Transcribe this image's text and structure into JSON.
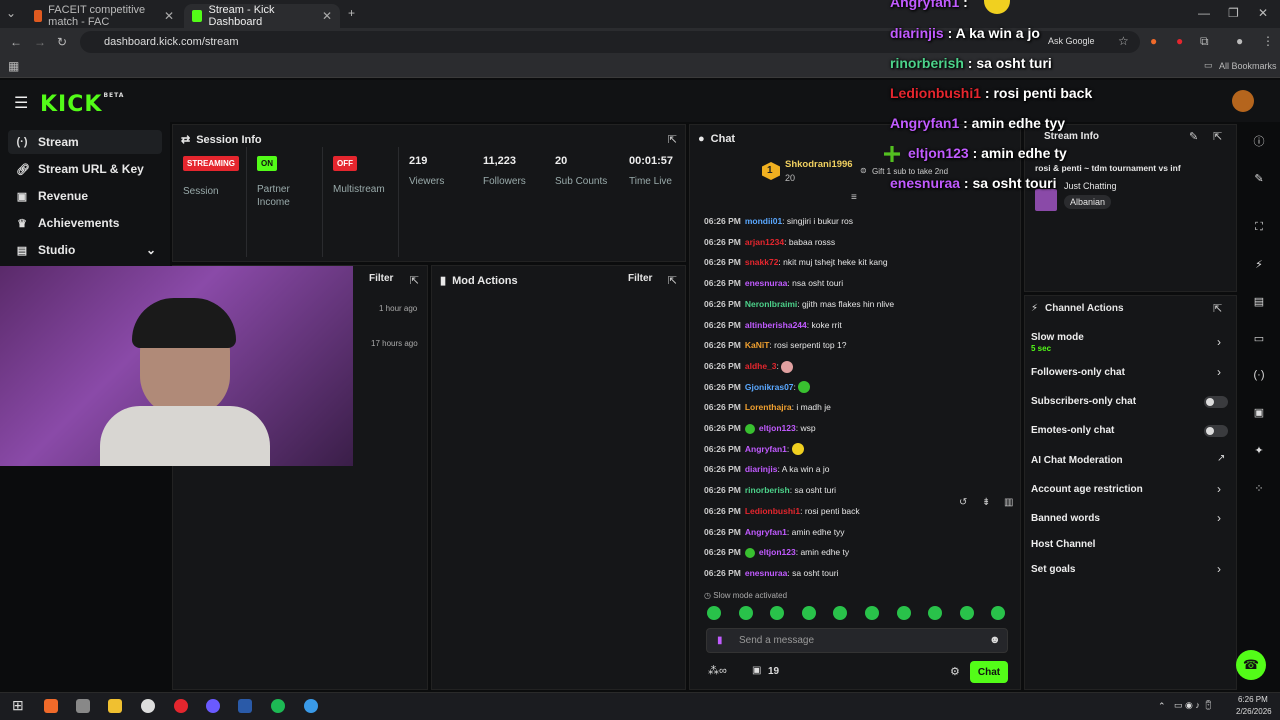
{
  "browser": {
    "tabs": [
      {
        "label": "FACEIT competitive match - FAC"
      },
      {
        "label": "Stream - Kick Dashboard"
      }
    ],
    "url": "dashboard.kick.com/stream",
    "ask_google": "Ask Google",
    "all_bookmarks": "All Bookmarks"
  },
  "app": {
    "logo": "KICK",
    "beta": "BETA"
  },
  "sidebar": {
    "items": [
      {
        "label": "Stream",
        "icon": "stream-icon"
      },
      {
        "label": "Stream URL & Key",
        "icon": "key-icon"
      },
      {
        "label": "Revenue",
        "icon": "revenue-icon"
      },
      {
        "label": "Achievements",
        "icon": "trophy-icon"
      },
      {
        "label": "Studio",
        "icon": "studio-icon"
      }
    ]
  },
  "session": {
    "title": "Session Info",
    "stats": [
      {
        "badge": "STREAMING",
        "label": "Session",
        "badge_color": "#e5262e"
      },
      {
        "badge": "ON",
        "label": "Partner Income",
        "badge_color": "#53fc18"
      },
      {
        "badge": "OFF",
        "label": "Multistream",
        "badge_color": "#e5262e"
      },
      {
        "value": "219",
        "label": "Viewers"
      },
      {
        "value": "11,223",
        "label": "Followers"
      },
      {
        "value": "20",
        "label": "Sub Counts"
      },
      {
        "value": "00:01:57",
        "label": "Time Live"
      }
    ]
  },
  "activity": {
    "filter": "Filter",
    "times": [
      "1 hour ago",
      "17 hours ago"
    ]
  },
  "mod": {
    "title": "Mod Actions",
    "filter": "Filter"
  },
  "chat": {
    "title": "Chat",
    "pinned_user": "Shkodrani1996",
    "pinned_count": "20",
    "gift_text": "Gift 1 sub to take 2nd",
    "messages": [
      {
        "time": "06:26 PM",
        "user": "mondii01",
        "color": "#5aa8ff",
        "text": "singjiri i bukur ros"
      },
      {
        "time": "06:26 PM",
        "user": "arjan1234",
        "color": "#e5262e",
        "text": "babaa rosss"
      },
      {
        "time": "06:26 PM",
        "user": "snakk72",
        "color": "#e5262e",
        "text": "nkit muj tshejt heke kit kang"
      },
      {
        "time": "06:26 PM",
        "user": "enesnuraa",
        "color": "#c15bff",
        "text": "nsa osht touri"
      },
      {
        "time": "06:26 PM",
        "user": "Neronlbraimi",
        "color": "#4cd28a",
        "text": "gjith mas flakes hin nlive"
      },
      {
        "time": "06:26 PM",
        "user": "altinberisha244",
        "color": "#c15bff",
        "text": "koke rrit"
      },
      {
        "time": "06:26 PM",
        "user": "KaNiT",
        "color": "#f0a030",
        "text": "rosi serpenti top 1?"
      },
      {
        "time": "06:26 PM",
        "user": "aldhe_3",
        "color": "#e5262e",
        "text": ""
      },
      {
        "time": "06:26 PM",
        "user": "Gjonikras07",
        "color": "#5aa8ff",
        "text": ""
      },
      {
        "time": "06:26 PM",
        "user": "Lorenthajra",
        "color": "#f0a030",
        "text": "i madh je"
      },
      {
        "time": "06:26 PM",
        "user": "eltjon123",
        "color": "#c15bff",
        "text": "wsp"
      },
      {
        "time": "06:26 PM",
        "user": "Angryfan1",
        "color": "#c15bff",
        "text": ""
      },
      {
        "time": "06:26 PM",
        "user": "diarinjis",
        "color": "#c15bff",
        "text": "A ka win a jo"
      },
      {
        "time": "06:26 PM",
        "user": "rinorberish",
        "color": "#4cd28a",
        "text": "sa osht turi"
      },
      {
        "time": "06:26 PM",
        "user": "Ledionbushi1",
        "color": "#e5262e",
        "text": "rosi penti back"
      },
      {
        "time": "06:26 PM",
        "user": "Angryfan1",
        "color": "#c15bff",
        "text": "amin edhe tyy"
      },
      {
        "time": "06:26 PM",
        "user": "eltjon123",
        "color": "#c15bff",
        "text": "amin edhe ty"
      },
      {
        "time": "06:26 PM",
        "user": "enesnuraa",
        "color": "#c15bff",
        "text": "sa osht touri"
      }
    ],
    "slow_mode_note": "Slow mode activated",
    "placeholder": "Send a message",
    "points": "19",
    "send": "Chat"
  },
  "stream_info": {
    "title": "Stream Info",
    "stream_title": "rosi & penti ~ tdm tournament vs inf",
    "category": "Just Chatting",
    "tag": "Albanian"
  },
  "channel_actions": {
    "title": "Channel Actions",
    "slow_mode": "Slow mode",
    "slow_mode_value": "5 sec",
    "items": [
      "Followers-only chat",
      "Subscribers-only chat",
      "Emotes-only chat",
      "AI Chat Moderation",
      "Account age restriction",
      "Banned words",
      "Host Channel",
      "Set goals"
    ]
  },
  "overlay": [
    {
      "user": "Angryfan1",
      "text": " :",
      "color": "#c15bff"
    },
    {
      "user": "diarinjis",
      "text": " : A ka win a jo",
      "color": "#c15bff"
    },
    {
      "user": "rinorberish",
      "text": " : sa osht turi",
      "color": "#4cd28a"
    },
    {
      "user": "Ledionbushi1",
      "text": " : rosi penti back",
      "color": "#e5262e"
    },
    {
      "user": "Angryfan1",
      "text": " : amin edhe tyy",
      "color": "#c15bff"
    },
    {
      "user": "eltjon123",
      "text": " : amin edhe ty",
      "color": "#c15bff"
    },
    {
      "user": "enesnuraa",
      "text": " : sa osht touri",
      "color": "#c15bff"
    }
  ],
  "taskbar": {
    "time": "6:26 PM",
    "date": "2/26/2026"
  }
}
